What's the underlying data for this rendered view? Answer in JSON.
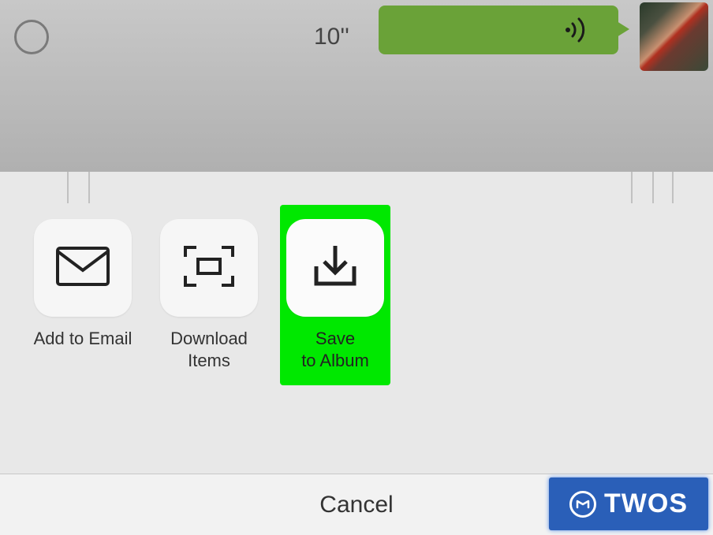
{
  "chat": {
    "voice_duration": "10''"
  },
  "share": {
    "items": [
      {
        "label": "Add to Email",
        "icon": "mail-icon"
      },
      {
        "label": "Download\nItems",
        "icon": "scan-icon"
      },
      {
        "label": "Save\nto Album",
        "icon": "download-tray-icon",
        "highlighted": true
      }
    ],
    "cancel_label": "Cancel"
  },
  "watermark": {
    "text": "TWOS"
  }
}
